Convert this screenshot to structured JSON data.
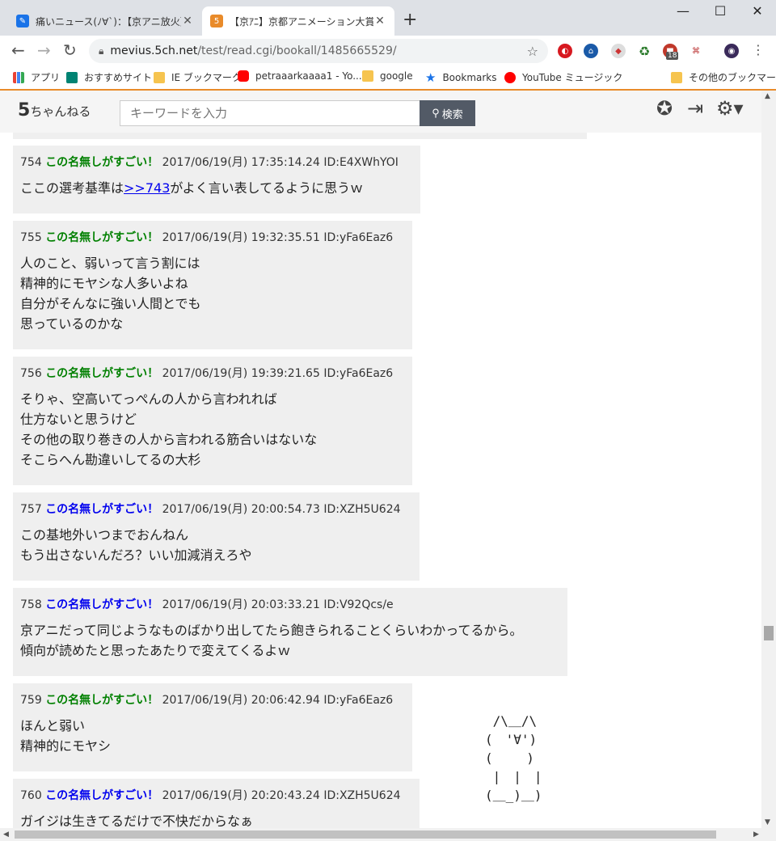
{
  "browser": {
    "tabs": [
      {
        "title": "痛いニュース(ﾉ∀`)：【京アニ放火】著",
        "favicon_color": "#1a73e8",
        "active": false
      },
      {
        "title": "【京ｱﾆ】京都アニメーション大賞【KAI",
        "favicon_color": "#e98b2a",
        "active": true
      }
    ],
    "new_tab": "+",
    "window_controls": [
      "—",
      "☐",
      "✕"
    ],
    "url_host": "mevius.5ch.net",
    "url_path": "/test/read.cgi/bookall/1485665529/",
    "extensions_badge": "18"
  },
  "bookmarks": [
    {
      "label": "アプリ",
      "icon": "apps-grid-icon",
      "color": "#4285f4"
    },
    {
      "label": "おすすめサイト",
      "icon": "bing-icon",
      "color": "#008373"
    },
    {
      "label": "IE ブックマーク",
      "icon": "folder-icon",
      "color": "#f6c44f"
    },
    {
      "label": "petraaarkaaaa1 - Yo...",
      "icon": "youtube-icon",
      "color": "#ff0000"
    },
    {
      "label": "google",
      "icon": "folder-icon",
      "color": "#f6c44f"
    },
    {
      "label": "Bookmarks",
      "icon": "star-icon",
      "color": "#1a73e8"
    },
    {
      "label": "YouTube ミュージック",
      "icon": "youtube-music-icon",
      "color": "#ff0000"
    },
    {
      "label": "その他のブックマーク",
      "icon": "folder-icon",
      "color": "#f6c44f"
    }
  ],
  "site": {
    "logo_main": "5",
    "logo_sub": "ちゃんねる",
    "search_placeholder": "キーワードを入力",
    "search_button": "検索",
    "header_icons": [
      "badge-icon",
      "login-icon",
      "settings-icon"
    ]
  },
  "posts": [
    {
      "num": "754",
      "name": "この名無しがすごい！",
      "name_color": "green",
      "date": "2017/06/19(月) 17:35:14.24",
      "id": "ID:E4XWhYOI",
      "pre": "ここの選考基準は",
      "link": ">>743",
      "post": "がよく言い表してるように思うｗ"
    },
    {
      "num": "755",
      "name": "この名無しがすごい！",
      "name_color": "green",
      "date": "2017/06/19(月) 19:32:35.51",
      "id": "ID:yFa6Eaz6",
      "pre": "人のこと、弱いって言う割には\n精神的にモヤシな人多いよね\n自分がそんなに強い人間とでも\n思っているのかな",
      "link": "",
      "post": ""
    },
    {
      "num": "756",
      "name": "この名無しがすごい！",
      "name_color": "green",
      "date": "2017/06/19(月) 19:39:21.65",
      "id": "ID:yFa6Eaz6",
      "pre": "そりゃ、空高いてっぺんの人から言われれば\n仕方ないと思うけど\nその他の取り巻きの人から言われる筋合いはないな\nそこらへん勘違いしてるの大杉",
      "link": "",
      "post": ""
    },
    {
      "num": "757",
      "name": "この名無しがすごい！",
      "name_color": "blue",
      "date": "2017/06/19(月) 20:00:54.73",
      "id": "ID:XZH5U624",
      "pre": "この基地外いつまでおんねん\nもう出さないんだろ？いい加減消えろや",
      "link": "",
      "post": ""
    },
    {
      "num": "758",
      "name": "この名無しがすごい！",
      "name_color": "blue",
      "date": "2017/06/19(月) 20:03:33.21",
      "id": "ID:V92Qcs/e",
      "pre": "京アニだって同じようなものばかり出してたら飽きられることくらいわかってるから。\n傾向が読めたと思ったあたりで変えてくるよｗ",
      "link": "",
      "post": ""
    },
    {
      "num": "759",
      "name": "この名無しがすごい！",
      "name_color": "green",
      "date": "2017/06/19(月) 20:06:42.94",
      "id": "ID:yFa6Eaz6",
      "pre": "ほんと弱い\n精神的にモヤシ",
      "link": "",
      "post": ""
    },
    {
      "num": "760",
      "name": "この名無しがすごい！",
      "name_color": "blue",
      "date": "2017/06/19(月) 20:20:43.24",
      "id": "ID:XZH5U624",
      "pre": "ガイジは生きてるだけで不快だからなぁ",
      "link": "",
      "post": ""
    }
  ],
  "ascii_art": " /\\＿/\\\n(　'∀')\n(　　 )\n |　|　|\n(＿_)＿)"
}
